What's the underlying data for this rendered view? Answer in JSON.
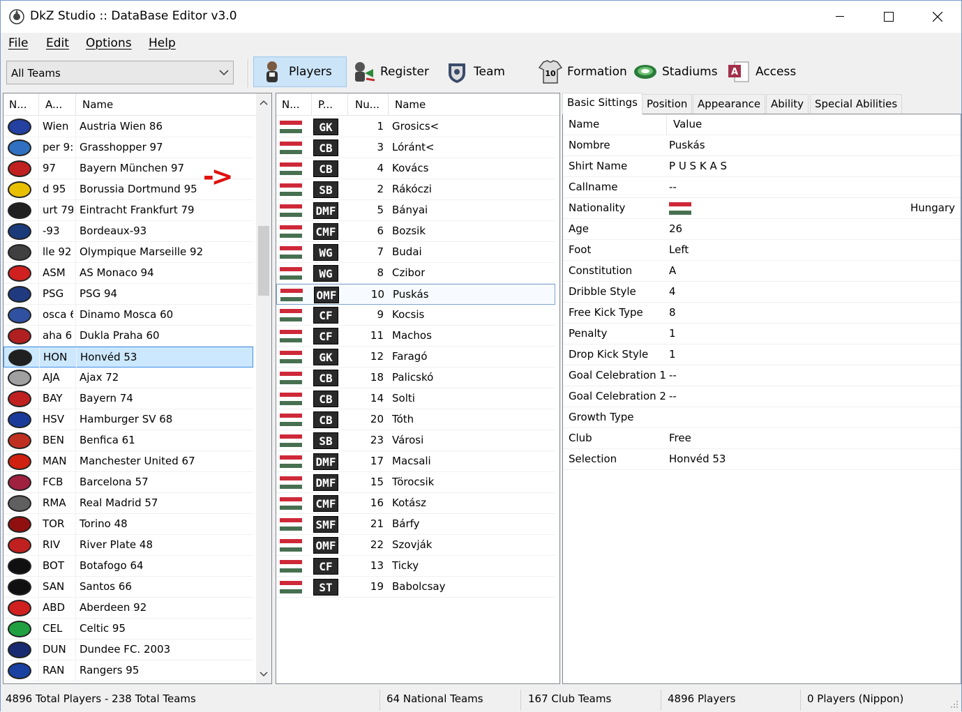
{
  "window": {
    "title": "DkZ Studio :: DataBase Editor v3.0"
  },
  "menu": [
    "File",
    "Edit",
    "Options",
    "Help"
  ],
  "toolbar": {
    "filter_value": "All Teams",
    "buttons": [
      "Players",
      "Register",
      "Team",
      "Formation",
      "Stadiums",
      "Access"
    ]
  },
  "annotation": "->",
  "teams": {
    "headers": [
      "N...",
      "A...",
      "Name"
    ],
    "rows": [
      {
        "abbr": "Wien",
        "name": "Austria Wien 86",
        "color": "#2440a0"
      },
      {
        "abbr": "per 9:",
        "name": "Grasshopper 97",
        "color": "#3070c0"
      },
      {
        "abbr": "97",
        "name": "Bayern München 97",
        "color": "#c02020"
      },
      {
        "abbr": "d 95",
        "name": "Borussia Dortmund 95",
        "color": "#e8c000"
      },
      {
        "abbr": "urt 79",
        "name": "Eintracht Frankfurt 79",
        "color": "#202020"
      },
      {
        "abbr": "-93",
        "name": "Bordeaux-93",
        "color": "#1a3a7a"
      },
      {
        "abbr": "lle 92",
        "name": "Olympique Marseille 92",
        "color": "#404040"
      },
      {
        "abbr": "ASM",
        "name": "AS Monaco 94",
        "color": "#d02020"
      },
      {
        "abbr": "PSG",
        "name": "PSG 94",
        "color": "#203a80"
      },
      {
        "abbr": "osca 6",
        "name": "Dinamo Mosca 60",
        "color": "#3050a0"
      },
      {
        "abbr": "aha 6",
        "name": "Dukla Praha 60",
        "color": "#b02020"
      },
      {
        "abbr": "HON",
        "name": "Honvéd 53",
        "color": "#202020"
      },
      {
        "abbr": "AJA",
        "name": "Ajax 72",
        "color": "#a0a0a0"
      },
      {
        "abbr": "BAY",
        "name": "Bayern 74",
        "color": "#c02020"
      },
      {
        "abbr": "HSV",
        "name": "Hamburger SV 68",
        "color": "#1a3a9a"
      },
      {
        "abbr": "BEN",
        "name": "Benfica 61",
        "color": "#c03020"
      },
      {
        "abbr": "MAN",
        "name": "Manchester United 67",
        "color": "#d02010"
      },
      {
        "abbr": "FCB",
        "name": "Barcelona 57",
        "color": "#a02040"
      },
      {
        "abbr": "RMA",
        "name": "Real Madrid 57",
        "color": "#606060"
      },
      {
        "abbr": "TOR",
        "name": "Torino 48",
        "color": "#901010"
      },
      {
        "abbr": "RIV",
        "name": "River Plate 48",
        "color": "#c02020"
      },
      {
        "abbr": "BOT",
        "name": "Botafogo 64",
        "color": "#101010"
      },
      {
        "abbr": "SAN",
        "name": "Santos 66",
        "color": "#101010"
      },
      {
        "abbr": "ABD",
        "name": "Aberdeen 92",
        "color": "#d02020"
      },
      {
        "abbr": "CEL",
        "name": "Celtic 95",
        "color": "#20a040"
      },
      {
        "abbr": "DUN",
        "name": "Dundee FC. 2003",
        "color": "#1a2a70"
      },
      {
        "abbr": "RAN",
        "name": "Rangers 95",
        "color": "#1a40a0"
      }
    ],
    "selected_index": 11
  },
  "players": {
    "headers": [
      "N...",
      "P...",
      "Nu...",
      "Name"
    ],
    "flag_colors": [
      "#ce2939",
      "#ffffff",
      "#477050"
    ],
    "rows": [
      {
        "pos": "GK",
        "num": "1",
        "name": "Grosics<"
      },
      {
        "pos": "CB",
        "num": "3",
        "name": "Lóránt<"
      },
      {
        "pos": "CB",
        "num": "4",
        "name": "Kovács"
      },
      {
        "pos": "SB",
        "num": "2",
        "name": "Rákóczi"
      },
      {
        "pos": "DMF",
        "num": "5",
        "name": "Bányai"
      },
      {
        "pos": "CMF",
        "num": "6",
        "name": "Bozsik"
      },
      {
        "pos": "WG",
        "num": "7",
        "name": "Budai"
      },
      {
        "pos": "WG",
        "num": "8",
        "name": "Czibor"
      },
      {
        "pos": "OMF",
        "num": "10",
        "name": "Puskás"
      },
      {
        "pos": "CF",
        "num": "9",
        "name": "Kocsis"
      },
      {
        "pos": "CF",
        "num": "11",
        "name": "Machos"
      },
      {
        "pos": "GK",
        "num": "12",
        "name": "Faragó"
      },
      {
        "pos": "CB",
        "num": "18",
        "name": "Palicskó"
      },
      {
        "pos": "CB",
        "num": "14",
        "name": "Solti"
      },
      {
        "pos": "CB",
        "num": "20",
        "name": "Tóth"
      },
      {
        "pos": "SB",
        "num": "23",
        "name": "Városi"
      },
      {
        "pos": "DMF",
        "num": "17",
        "name": "Macsali"
      },
      {
        "pos": "DMF",
        "num": "15",
        "name": "Törocsik"
      },
      {
        "pos": "CMF",
        "num": "16",
        "name": "Kotász"
      },
      {
        "pos": "SMF",
        "num": "21",
        "name": "Bárfy"
      },
      {
        "pos": "OMF",
        "num": "22",
        "name": "Szovják"
      },
      {
        "pos": "CF",
        "num": "13",
        "name": "Ticky"
      },
      {
        "pos": "ST",
        "num": "19",
        "name": "Babolcsay"
      }
    ],
    "hover_index": 8
  },
  "tabs": [
    "Basic Sittings",
    "Position",
    "Appearance",
    "Ability",
    "Special Abilities"
  ],
  "properties": {
    "headers": [
      "Name",
      "Value"
    ],
    "rows": [
      {
        "name": "Nombre",
        "value": "Puskás"
      },
      {
        "name": "Shirt Name",
        "value": "P U S K A S"
      },
      {
        "name": "Callname",
        "value": "--"
      },
      {
        "name": "Nationality",
        "value": "Hungary"
      },
      {
        "name": "Age",
        "value": "26"
      },
      {
        "name": "Foot",
        "value": "Left"
      },
      {
        "name": "Constitution",
        "value": "A"
      },
      {
        "name": "Dribble Style",
        "value": "4"
      },
      {
        "name": "Free Kick Type",
        "value": "8"
      },
      {
        "name": "Penalty",
        "value": "1"
      },
      {
        "name": "Drop Kick Style",
        "value": "1"
      },
      {
        "name": "Goal Celebration 1",
        "value": "--"
      },
      {
        "name": "Goal Celebration 2",
        "value": "--"
      },
      {
        "name": "Growth Type",
        "value": ""
      },
      {
        "name": "Club",
        "value": "Free"
      },
      {
        "name": "Selection",
        "value": "Honvéd 53"
      }
    ]
  },
  "status": [
    "4896 Total Players  -  238 Total Teams",
    "64 National Teams",
    "167 Club Teams",
    "4896 Players",
    "0 Players (Nippon)"
  ]
}
